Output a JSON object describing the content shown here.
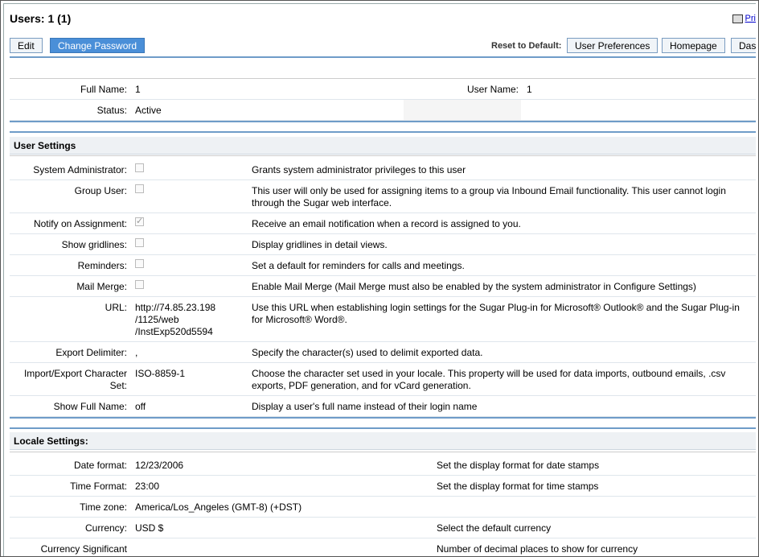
{
  "header": {
    "title": "Users: 1 (1)",
    "print_label": "Pri"
  },
  "toolbar": {
    "edit_label": "Edit",
    "change_password_label": "Change Password",
    "reset_label": "Reset to Default:",
    "user_preferences_label": "User Preferences",
    "homepage_label": "Homepage",
    "dashboard_label": "Das"
  },
  "basic": {
    "full_name_label": "Full Name:",
    "full_name_value": "1",
    "user_name_label": "User Name:",
    "user_name_value": "1",
    "status_label": "Status:",
    "status_value": "Active"
  },
  "user_settings": {
    "heading": "User Settings",
    "rows": [
      {
        "label": "System Administrator:",
        "type": "checkbox",
        "checked": false,
        "desc": "Grants system administrator privileges to this user"
      },
      {
        "label": "Group User:",
        "type": "checkbox",
        "checked": false,
        "desc": "This user will only be used for assigning items to a group via Inbound Email functionality. This user cannot login through the Sugar web interface."
      },
      {
        "label": "Notify on Assignment:",
        "type": "checkbox",
        "checked": true,
        "desc": "Receive an email notification when a record is assigned to you."
      },
      {
        "label": "Show gridlines:",
        "type": "checkbox",
        "checked": false,
        "desc": "Display gridlines in detail views."
      },
      {
        "label": "Reminders:",
        "type": "checkbox",
        "checked": false,
        "desc": "Set a default for reminders for calls and meetings."
      },
      {
        "label": "Mail Merge:",
        "type": "checkbox",
        "checked": false,
        "desc": "Enable Mail Merge (Mail Merge must also be enabled by the system administrator in Configure Settings)"
      },
      {
        "label": "URL:",
        "type": "text",
        "value": "http://74.85.23.198 /1125/web /InstExp520d5594",
        "desc": "Use this URL when establishing login settings for the Sugar Plug-in for Microsoft® Outlook® and the Sugar Plug-in for Microsoft® Word®."
      },
      {
        "label": "Export Delimiter:",
        "type": "text",
        "value": ",",
        "desc": "Specify the character(s) used to delimit exported data."
      },
      {
        "label": "Import/Export Character Set:",
        "type": "text",
        "value": "ISO-8859-1",
        "desc": "Choose the character set used in your locale. This property will be used for data imports, outbound emails, .csv exports, PDF generation, and for vCard generation."
      },
      {
        "label": "Show Full Name:",
        "type": "text",
        "value": "off",
        "desc": "Display a user's full name instead of their login name"
      }
    ]
  },
  "locale_settings": {
    "heading": "Locale Settings:",
    "rows": [
      {
        "label": "Date format:",
        "value": "12/23/2006",
        "desc": "Set the display format for date stamps"
      },
      {
        "label": "Time Format:",
        "value": "23:00",
        "desc": "Set the display format for time stamps"
      },
      {
        "label": "Time zone:",
        "value": "America/Los_Angeles (GMT-8) (+DST)",
        "desc": ""
      },
      {
        "label": "Currency:",
        "value": "USD $",
        "desc": "Select the default currency"
      },
      {
        "label": "Currency Significant",
        "value": "",
        "desc": "Number of decimal places to show for currency"
      }
    ]
  }
}
